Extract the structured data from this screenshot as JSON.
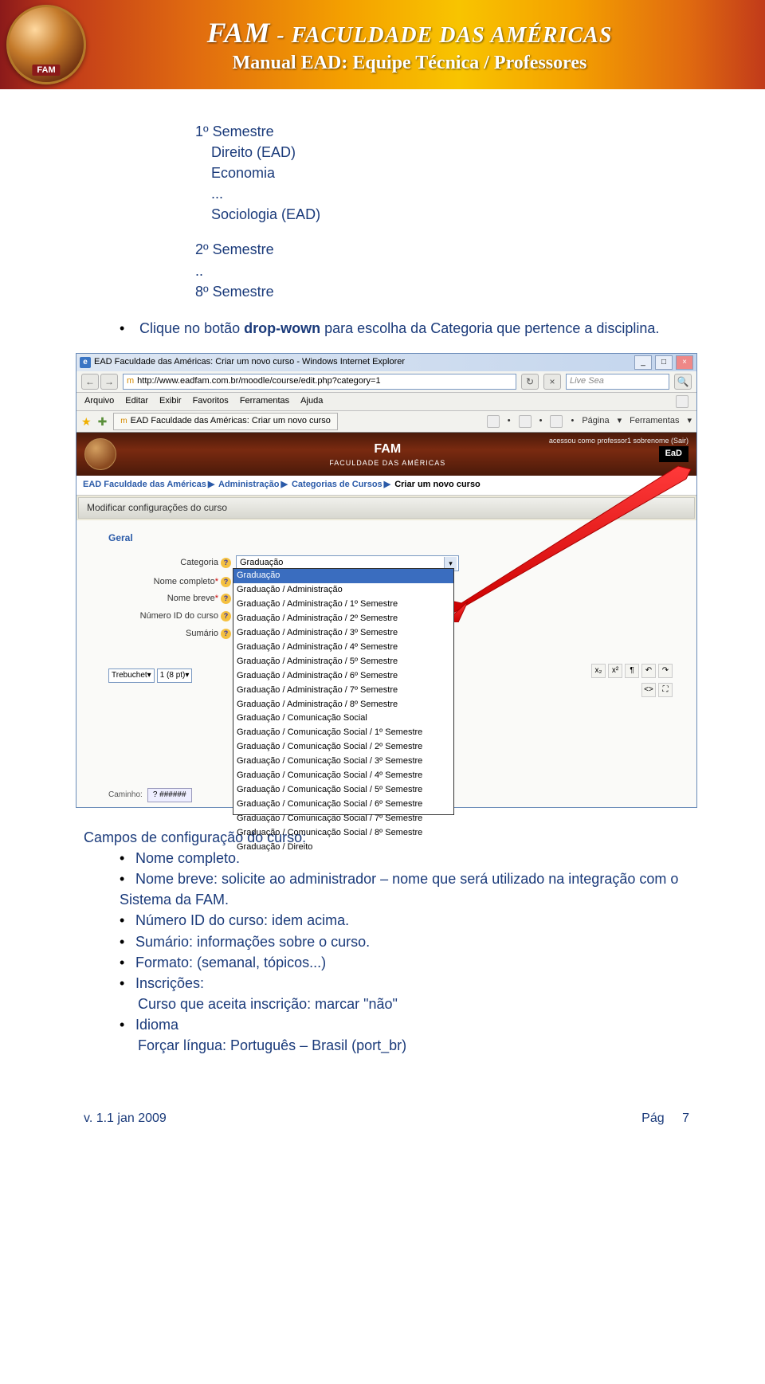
{
  "banner": {
    "fam": "FAM",
    "rest": " - FACULDADE DAS AMÉRICAS",
    "line2": "Manual EAD: Equipe Técnica / Professores"
  },
  "doc": {
    "sem1": "1º Semestre",
    "direito": "    Direito (EAD)",
    "economia": "    Economia",
    "dots1": "    ...",
    "sociologia": "    Sociologia (EAD)",
    "sem2": "2º Semestre",
    "dots2": "..",
    "sem8": "8º Semestre",
    "bullet1_pre": "Clique no botão ",
    "bullet1_bold": "drop-wown",
    "bullet1_post": " para escolha da Categoria que pertence a disciplina."
  },
  "ie": {
    "title": "EAD Faculdade das Américas: Criar um novo curso - Windows Internet Explorer",
    "url": "http://www.eadfam.com.br/moodle/course/edit.php?category=1",
    "search_ph": "Live Sea",
    "menus": [
      "Arquivo",
      "Editar",
      "Exibir",
      "Favoritos",
      "Ferramentas",
      "Ajuda"
    ],
    "tab": "EAD Faculdade das Américas: Criar um novo curso",
    "tabbar_right": [
      "Página",
      "Ferramentas"
    ],
    "page_fam": "FAM",
    "page_fac": "FACULDADE DAS AMÉRICAS",
    "ead": "EaD",
    "login": "acessou como professor1 sobrenome (Sair)",
    "breadcrumb": [
      "EAD Faculdade das Américas",
      "Administração",
      "Categorias de Cursos",
      "Criar um novo curso"
    ],
    "section_title": "Modificar configurações do curso",
    "geral": "Geral",
    "labels": {
      "categoria": "Categoria",
      "nome_completo": "Nome completo",
      "nome_breve": "Nome breve",
      "numero_id": "Número ID do curso",
      "sumario": "Sumário"
    },
    "cat_value": "Graduação",
    "tb_font": "Trebuchet",
    "tb_size": "1 (8 pt)",
    "caminho": "Caminho:",
    "dropdown": [
      "Graduação",
      "Graduação / Administração",
      "Graduação / Administração / 1º Semestre",
      "Graduação / Administração / 2º Semestre",
      "Graduação / Administração / 3º Semestre",
      "Graduação / Administração / 4º Semestre",
      "Graduação / Administração / 5º Semestre",
      "Graduação / Administração / 6º Semestre",
      "Graduação / Administração / 7º Semestre",
      "Graduação / Administração / 8º Semestre",
      "Graduação / Comunicação Social",
      "Graduação / Comunicação Social / 1º Semestre",
      "Graduação / Comunicação Social / 2º Semestre",
      "Graduação / Comunicação Social / 3º Semestre",
      "Graduação / Comunicação Social / 4º Semestre",
      "Graduação / Comunicação Social / 5º Semestre",
      "Graduação / Comunicação Social / 6º Semestre",
      "Graduação / Comunicação Social / 7º Semestre",
      "Graduação / Comunicação Social / 8º Semestre",
      "Graduação / Direito"
    ]
  },
  "section2": {
    "heading": "Campos de configuração do curso:",
    "items": [
      "Nome completo.",
      "Nome breve: solicite ao administrador – nome que será utilizado na integração com o Sistema da FAM.",
      "Número ID do curso: idem acima.",
      "Sumário: informações sobre o curso.",
      "Formato: (semanal, tópicos...)",
      "Inscrições:",
      "Idioma"
    ],
    "inscricoes_sub": "Curso que aceita inscrição: marcar \"não\"",
    "idioma_sub": "Forçar língua: Português – Brasil (port_br)"
  },
  "footer": {
    "left": "v. 1.1 jan 2009",
    "pg_label": "Pág",
    "pg_num": "7"
  }
}
